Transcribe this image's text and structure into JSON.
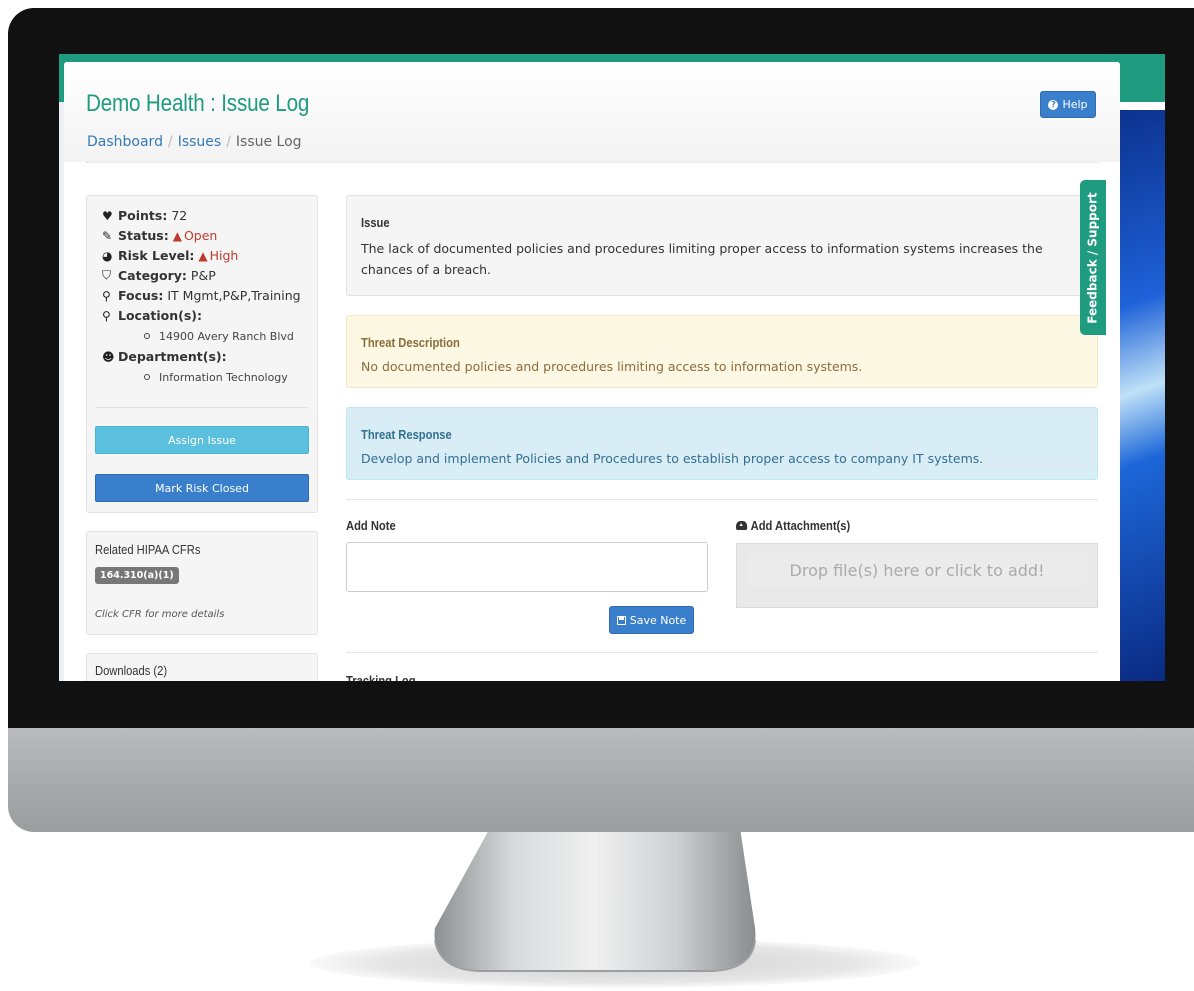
{
  "header": {
    "title": "Demo Health : Issue Log",
    "help_label": "Help",
    "breadcrumb": [
      "Dashboard",
      "Issues",
      "Issue Log"
    ]
  },
  "sidebar": {
    "points_label": "Points:",
    "points_value": "72",
    "status_label": "Status:",
    "status_value": "Open",
    "risk_label": "Risk Level:",
    "risk_value": "High",
    "category_label": "Category:",
    "category_value": "P&P",
    "focus_label": "Focus:",
    "focus_value": "IT Mgmt,P&P,Training",
    "locations_label": "Location(s):",
    "locations": [
      "14900 Avery Ranch Blvd"
    ],
    "departments_label": "Department(s):",
    "departments": [
      "Information Technology"
    ],
    "assign_button": "Assign Issue",
    "close_button": "Mark Risk Closed"
  },
  "cfr_box": {
    "title": "Related HIPAA CFRs",
    "badge": "164.310(a)(1)",
    "note": "Click CFR for more details"
  },
  "downloads_box": {
    "title": "Downloads (2)"
  },
  "issue": {
    "title": "Issue",
    "body": "The lack of documented policies and procedures limiting proper access to information systems increases the chances of a breach."
  },
  "threat_description": {
    "title": "Threat Description",
    "body": "No documented policies and procedures limiting access to information systems."
  },
  "threat_response": {
    "title": "Threat Response",
    "body": "Develop and implement Policies and Procedures to establish proper access to company IT systems."
  },
  "note": {
    "label": "Add Note",
    "value": "",
    "save_label": "Save Note"
  },
  "attachment": {
    "label": "Add Attachment(s)",
    "dropzone_text": "Drop file(s) here or click to add!"
  },
  "tracking_log": {
    "title": "Tracking Log"
  },
  "feedback_tab": "Feedback / Support",
  "colors": {
    "brand_teal": "#1f9b80",
    "primary_blue": "#3a7fcb",
    "info_blue": "#5bc0de",
    "danger_red": "#c0392b"
  }
}
